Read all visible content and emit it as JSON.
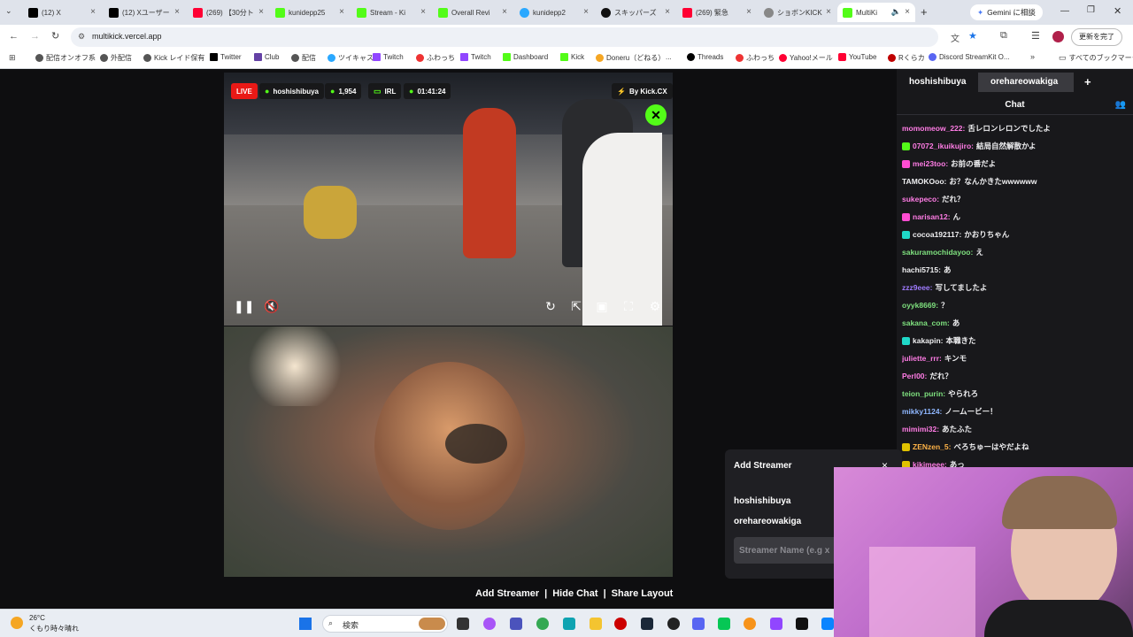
{
  "browser": {
    "tabs": [
      {
        "title": "(12) X"
      },
      {
        "title": "(12) Xユーザー"
      },
      {
        "title": "(269) 【30分ト"
      },
      {
        "title": "kunidepp25"
      },
      {
        "title": "Stream - Ki"
      },
      {
        "title": "Overall Revi"
      },
      {
        "title": "kunidepp2"
      },
      {
        "title": "スキッパーズ"
      },
      {
        "title": "(269) 緊急"
      },
      {
        "title": "ショボンKICK"
      },
      {
        "title": "MultiKi"
      }
    ],
    "gemini_label": "Gemini に相談",
    "url": "multikick.vercel.app",
    "update_label": "更新を完了",
    "bookmarks": [
      "配信オンオフ系",
      "外配信",
      "Kick レイド保有",
      "Twitter",
      "Club",
      "配信",
      "ツイキャス",
      "Twitch",
      "ふわっち",
      "Twitch",
      "Dashboard",
      "Kick",
      "Doneru（どねる）",
      "...",
      "Threads",
      "ふわっち",
      "Yahoo!メール",
      "YouTube",
      "Rくらカ",
      "Discord StreamKit O...",
      "すべてのブックマーク"
    ]
  },
  "stream1": {
    "live_label": "LIVE",
    "channel": "hoshishibuya",
    "viewers": "1,954",
    "category": "IRL",
    "uptime": "01:41:24",
    "by_label": "By Kick.CX"
  },
  "footer": {
    "add_streamer": "Add Streamer",
    "sep1": "|",
    "hide_chat": "Hide Chat",
    "sep2": "|",
    "share_layout": "Share Layout"
  },
  "chat": {
    "tabs": [
      "hoshishibuya",
      "orehareowakiga"
    ],
    "add_tab": "+",
    "header": "Chat",
    "messages": [
      {
        "user": "momomeow_222:",
        "text": "舌レロンレロンでしたよ",
        "color": "#ff7ce5",
        "icon": ""
      },
      {
        "user": "07072_ikuikujiro:",
        "text": "結局自然解散かよ",
        "color": "#ff7ce5",
        "icon": "#53fc18"
      },
      {
        "user": "mei23too:",
        "text": "お前の番だよ",
        "color": "#ff7ce5",
        "icon": "#ff4dd2"
      },
      {
        "user": "TAMOKOoo:",
        "text": "お？なんかきたwwwwww",
        "color": "#efeff1",
        "icon": ""
      },
      {
        "user": "sukepeco:",
        "text": "だれ？",
        "color": "#ff7ce5",
        "icon": ""
      },
      {
        "user": "narisan12:",
        "text": "ん",
        "color": "#ff7ce5",
        "icon": "#ff4dd2"
      },
      {
        "user": "cocoa192117:",
        "text": "かおりちゃん",
        "color": "#efeff1",
        "icon": "#1fd8c8"
      },
      {
        "user": "sakuramochidayoo:",
        "text": "え",
        "color": "#7ee07e",
        "icon": ""
      },
      {
        "user": "hachi5715:",
        "text": "あ",
        "color": "#efeff1",
        "icon": ""
      },
      {
        "user": "zzz9eee:",
        "text": "写してましたよ",
        "color": "#9f7bff",
        "icon": ""
      },
      {
        "user": "oyyk8669:",
        "text": "？",
        "color": "#7ee07e",
        "icon": ""
      },
      {
        "user": "sakana_com:",
        "text": "あ",
        "color": "#7ee07e",
        "icon": ""
      },
      {
        "user": "kakapin:",
        "text": "本職きた",
        "color": "#efeff1",
        "icon": "#1fd8c8"
      },
      {
        "user": "juliette_rrr:",
        "text": "キンモ",
        "color": "#ff7ce5",
        "icon": ""
      },
      {
        "user": "Perl00:",
        "text": "だれ？",
        "color": "#ff7ce5",
        "icon": ""
      },
      {
        "user": "teion_purin:",
        "text": "やられろ",
        "color": "#7ee07e",
        "icon": ""
      },
      {
        "user": "mikky1124:",
        "text": "ノームービー！",
        "color": "#8fb7ff",
        "icon": ""
      },
      {
        "user": "mimimi32:",
        "text": "あたふた",
        "color": "#ff7ce5",
        "icon": ""
      },
      {
        "user": "ZENzen_5:",
        "text": "べろちゅーはやだよね",
        "color": "#ffb347",
        "icon": "#e0c200"
      },
      {
        "user": "kikimeee:",
        "text": "あっ",
        "color": "#ff7ce5",
        "icon": "#e0c200"
      }
    ]
  },
  "add_modal": {
    "title": "Add Streamer",
    "close": "×",
    "streamers": [
      "hoshishibuya",
      "orehareowakiga"
    ],
    "placeholder": "Streamer Name (e.g x"
  },
  "taskbar": {
    "temp": "26°C",
    "weather": "くもり時々晴れ",
    "search_placeholder": "検索"
  },
  "icons": {
    "pause": "pause-icon",
    "mute": "mute-icon",
    "reload": "reload-icon",
    "popout": "popout-icon",
    "pip": "pip-icon",
    "fullscreen": "fullscreen-icon",
    "settings": "gear-icon"
  },
  "colors": {
    "kick_green": "#53fc18",
    "live_red": "#e91916"
  }
}
